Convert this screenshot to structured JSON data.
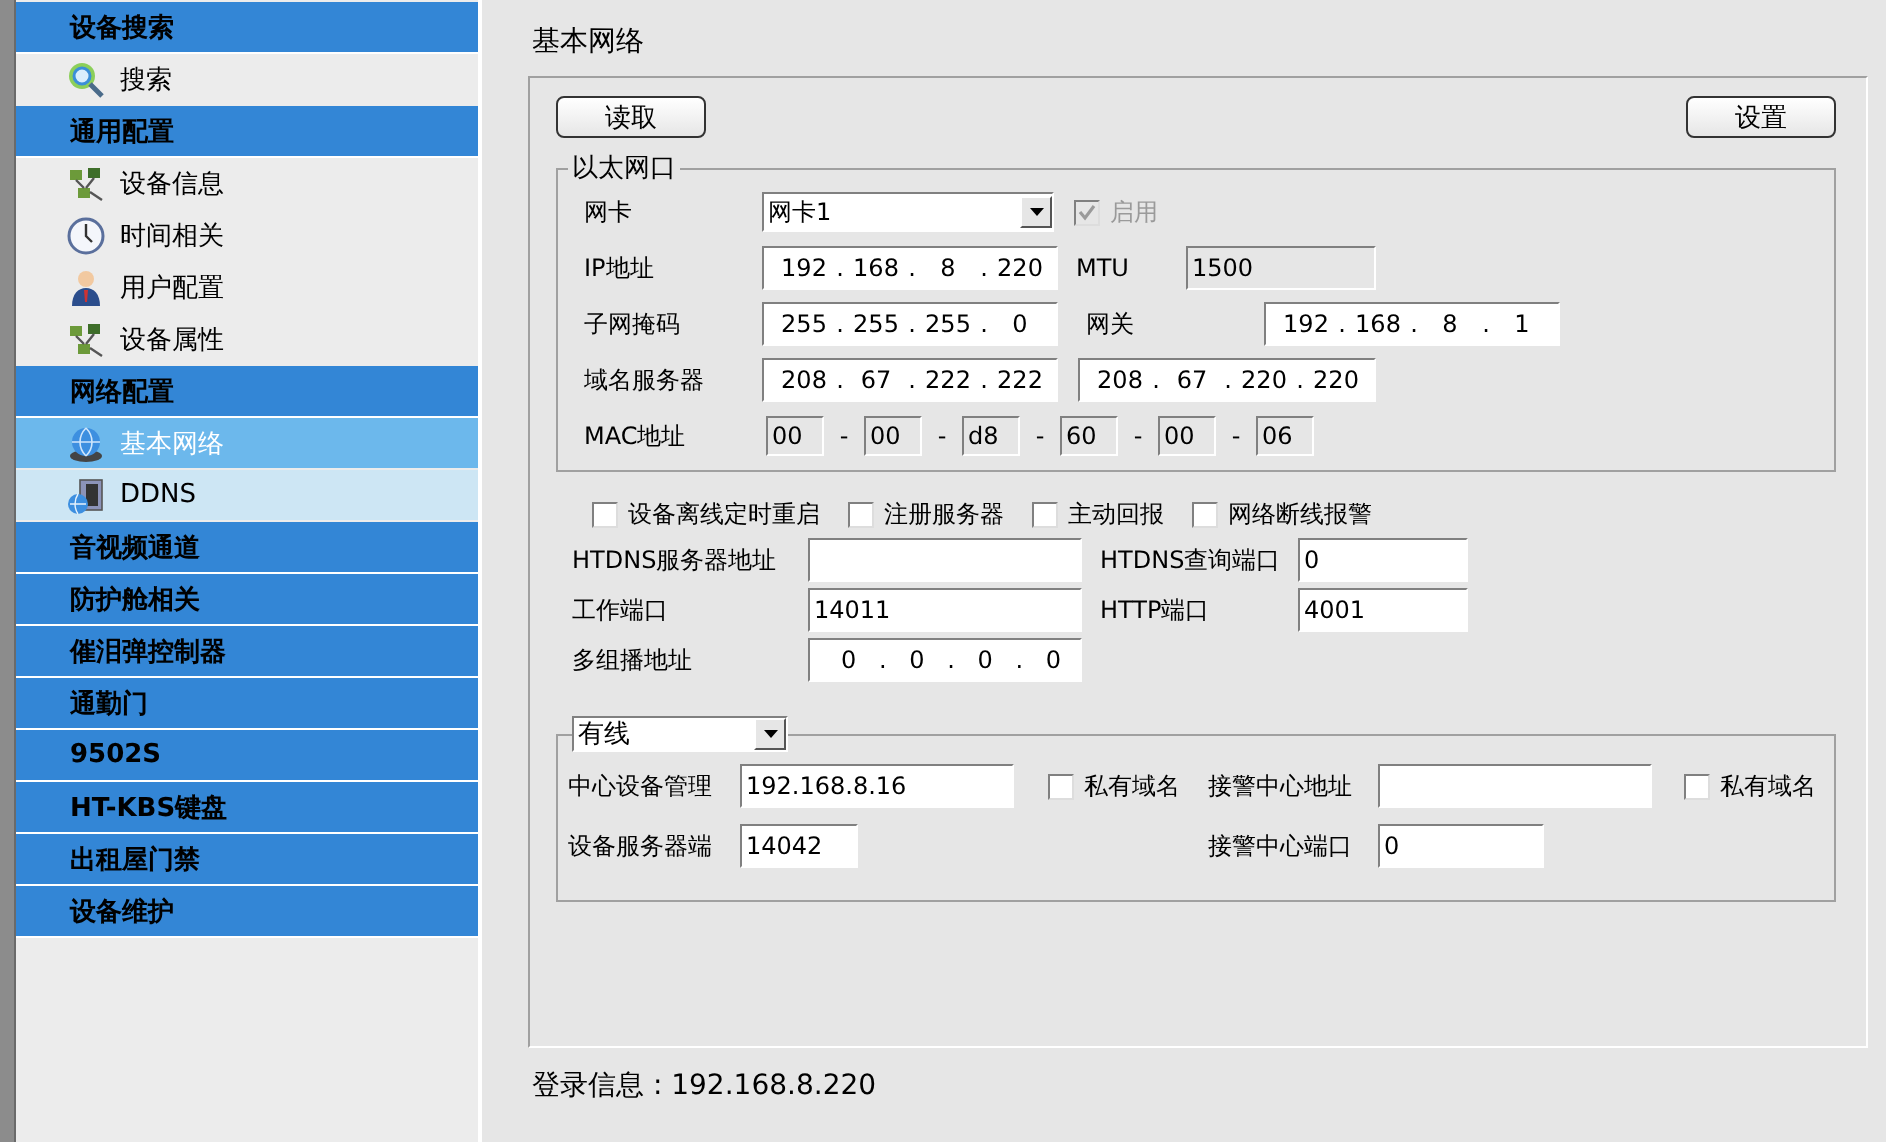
{
  "sidebar": {
    "groups": [
      {
        "title": "设备搜索",
        "items": [
          {
            "label": "搜索",
            "kind": "search",
            "selected": false,
            "highlighted": false
          }
        ]
      },
      {
        "title": "通用配置",
        "items": [
          {
            "label": "设备信息",
            "kind": "devices",
            "selected": false,
            "highlighted": false
          },
          {
            "label": "时间相关",
            "kind": "clock",
            "selected": false,
            "highlighted": false
          },
          {
            "label": "用户配置",
            "kind": "user",
            "selected": false,
            "highlighted": false
          },
          {
            "label": "设备属性",
            "kind": "devices",
            "selected": false,
            "highlighted": false
          }
        ]
      },
      {
        "title": "网络配置",
        "items": [
          {
            "label": "基本网络",
            "kind": "globe",
            "selected": true,
            "highlighted": false
          },
          {
            "label": "DDNS",
            "kind": "server",
            "selected": false,
            "highlighted": true
          }
        ]
      },
      {
        "title": "音视频通道"
      },
      {
        "title": "防护舱相关"
      },
      {
        "title": "催泪弹控制器"
      },
      {
        "title": "通勤门"
      },
      {
        "title": "9502S"
      },
      {
        "title": "HT-KBS键盘"
      },
      {
        "title": "出租屋门禁"
      },
      {
        "title": "设备维护"
      }
    ]
  },
  "panel": {
    "title": "基本网络",
    "read_button": "读取",
    "set_button": "设置",
    "ethernet": {
      "legend": "以太网口",
      "nic": {
        "label": "网卡",
        "value": "网卡1"
      },
      "enable": {
        "label": "启用",
        "checked": true,
        "disabled": true
      },
      "ip": {
        "label": "IP地址",
        "segments": [
          "192",
          ".",
          "168",
          ".",
          "8",
          ".",
          "220"
        ]
      },
      "mtu": {
        "label": "MTU",
        "value": "1500",
        "disabled": true
      },
      "subnet": {
        "label": "子网掩码",
        "segments": [
          "255",
          ".",
          "255",
          ".",
          "255",
          ".",
          "0"
        ]
      },
      "gateway": {
        "label": "网关",
        "segments": [
          "192",
          ".",
          "168",
          ".",
          "8",
          ".",
          "1"
        ]
      },
      "dns": {
        "label": "域名服务器",
        "primary": [
          "208",
          ".",
          "67",
          ".",
          "222",
          ".",
          "222"
        ],
        "secondary": [
          "208",
          ".",
          "67",
          ".",
          "220",
          ".",
          "220"
        ]
      },
      "mac": {
        "label": "MAC地址",
        "disabled": true,
        "segments": [
          "00",
          "-",
          "00",
          "-",
          "d8",
          "-",
          "60",
          "-",
          "00",
          "-",
          "06"
        ]
      }
    },
    "options": [
      {
        "label": "设备离线定时重启",
        "checked": false
      },
      {
        "label": "注册服务器",
        "checked": false
      },
      {
        "label": "主动回报",
        "checked": false
      },
      {
        "label": "网络断线报警",
        "checked": false
      }
    ],
    "htdns_server": {
      "label": "HTDNS服务器地址"
    },
    "htdns_port": {
      "label": "HTDNS查询端口",
      "value": "0"
    },
    "work_port": {
      "label": "工作端口",
      "value": "14011"
    },
    "http_port": {
      "label": "HTTP端口",
      "value": "4001"
    },
    "multicast": {
      "label": "多组播地址",
      "segments": [
        "0",
        ".",
        "0",
        ".",
        "0",
        ".",
        "0"
      ]
    },
    "center": {
      "mode": "有线",
      "device_management": {
        "label": "中心设备管理",
        "value": "192.168.8.16"
      },
      "private_domain_1": {
        "label": "私有域名",
        "checked": false
      },
      "alarm_address": {
        "label": "接警中心地址"
      },
      "private_domain_2": {
        "label": "私有域名",
        "checked": false
      },
      "server_port": {
        "label": "设备服务器端",
        "value": "14042"
      },
      "alarm_port": {
        "label": "接警中心端口",
        "value": "0"
      }
    }
  },
  "status": "登录信息 : 192.168.8.220"
}
